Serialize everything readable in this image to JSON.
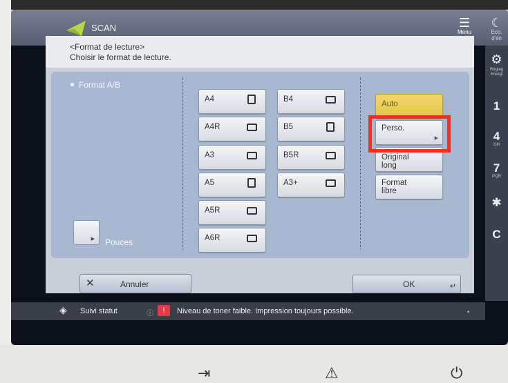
{
  "window": {
    "title": "SCAN"
  },
  "header": {
    "menu_label": "Menu",
    "eco_label": "Eco. d'én"
  },
  "side_panel": {
    "settings_label": "Réglag Energi",
    "keys": [
      {
        "label": "1",
        "sub": ""
      },
      {
        "label": "4",
        "sub": "GH"
      },
      {
        "label": "7",
        "sub": "PQR"
      },
      {
        "label": "✱",
        "sub": ""
      },
      {
        "label": "C",
        "sub": ""
      }
    ]
  },
  "page": {
    "heading": "<Format de lecture>",
    "subheading": "Choisir le format de lecture."
  },
  "category": {
    "label": "Format A/B"
  },
  "sizes_col1": [
    {
      "label": "A4",
      "icon": "portrait-page-icon"
    },
    {
      "label": "A4R",
      "icon": "landscape-page-icon"
    },
    {
      "label": "A3",
      "icon": "landscape-page-icon"
    },
    {
      "label": "A5",
      "icon": "portrait-page-icon"
    },
    {
      "label": "A5R",
      "icon": "landscape-page-icon"
    },
    {
      "label": "A6R",
      "icon": "landscape-page-icon"
    }
  ],
  "sizes_col2": [
    {
      "label": "B4",
      "icon": "landscape-page-icon"
    },
    {
      "label": "B5",
      "icon": "portrait-page-icon"
    },
    {
      "label": "B5R",
      "icon": "landscape-page-icon"
    },
    {
      "label": "A3+",
      "icon": "landscape-page-icon"
    }
  ],
  "options": {
    "auto": "Auto",
    "perso": "Perso.",
    "original_long": "Original long",
    "format_libre": "Format libre"
  },
  "units": {
    "label": "Pouces"
  },
  "actions": {
    "cancel": "Annuler",
    "ok": "OK"
  },
  "status": {
    "monitor_label": "Suivi statut",
    "message": "Niveau de toner faible. Impression toujours possible."
  },
  "colors": {
    "selected_option": "#e4c34a",
    "highlight_box": "#ff2a1a",
    "panel_background": "#a9b8d1"
  }
}
